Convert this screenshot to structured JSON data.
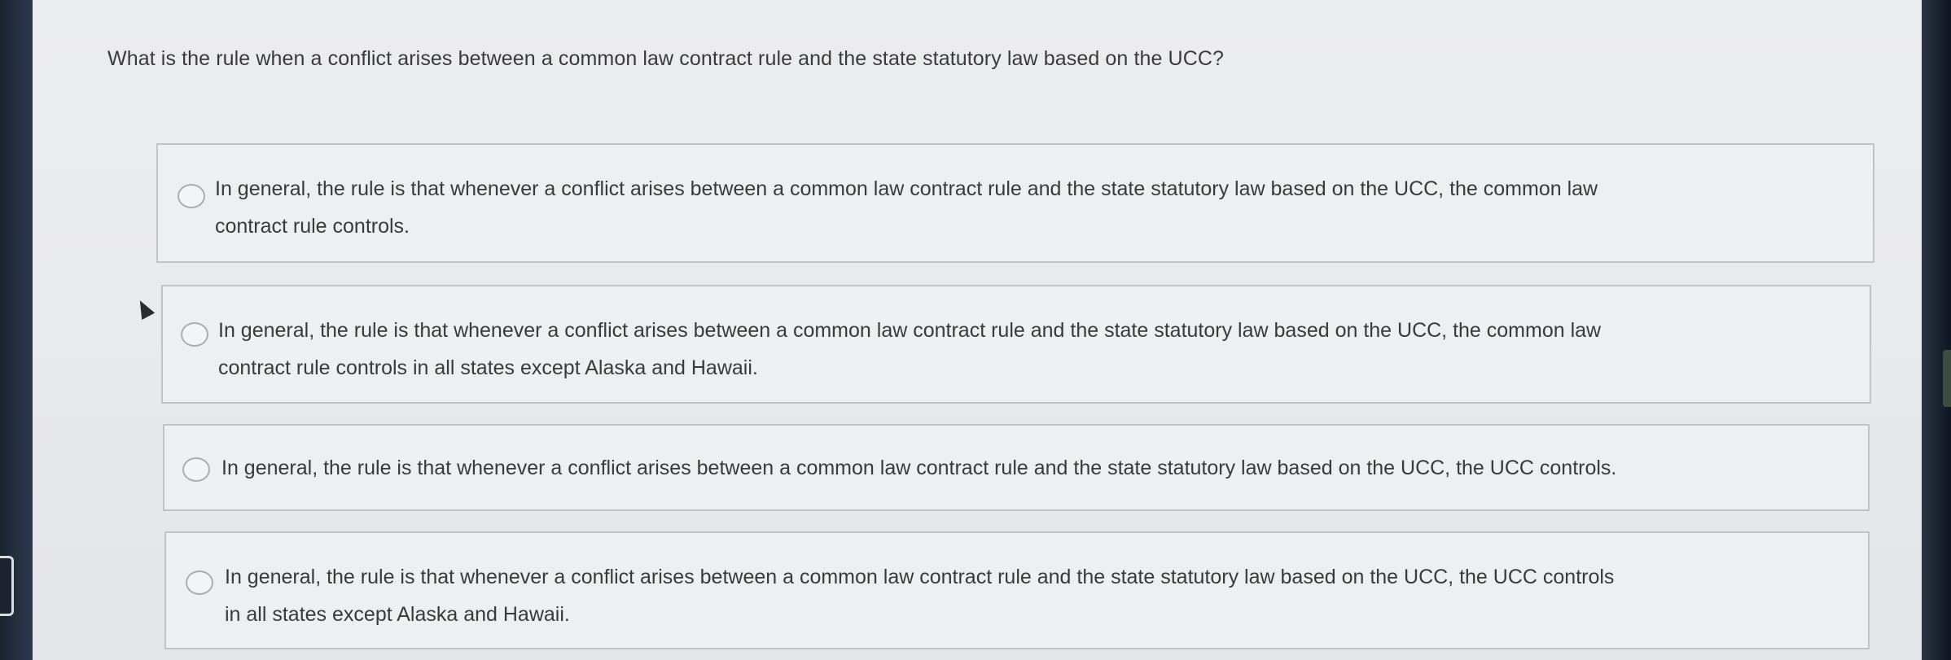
{
  "question": {
    "text": "What is the rule when a conflict arises between a common law contract rule and the state statutory law based on the UCC?"
  },
  "options": [
    {
      "line1": "In general, the rule is that whenever a conflict arises between a common law contract rule and the state statutory law based on the UCC, the common law",
      "line2": "contract rule controls.",
      "selected": false
    },
    {
      "line1": "In general, the rule is that whenever a conflict arises between a common law contract rule and the state statutory law based on the UCC, the common law",
      "line2": "contract rule controls in all states except Alaska and Hawaii.",
      "selected": false
    },
    {
      "line1": "In general, the rule is that whenever a conflict arises between a common law contract rule and the state statutory law based on the UCC, the UCC controls.",
      "selected": false
    },
    {
      "line1": "In general, the rule is that whenever a conflict arises between a common law contract rule and the state statutory law based on the UCC, the UCC controls",
      "line2": "in all states except Alaska and Hawaii.",
      "selected": false
    }
  ],
  "icons": {
    "radio": "radio-button-empty-icon",
    "cursor": "mouse-pointer-icon"
  },
  "colors": {
    "page_background": "#ebecee",
    "text": "#3a3a3a",
    "option_border": "#bfc2c7",
    "bezel": "#1f2a3a"
  }
}
